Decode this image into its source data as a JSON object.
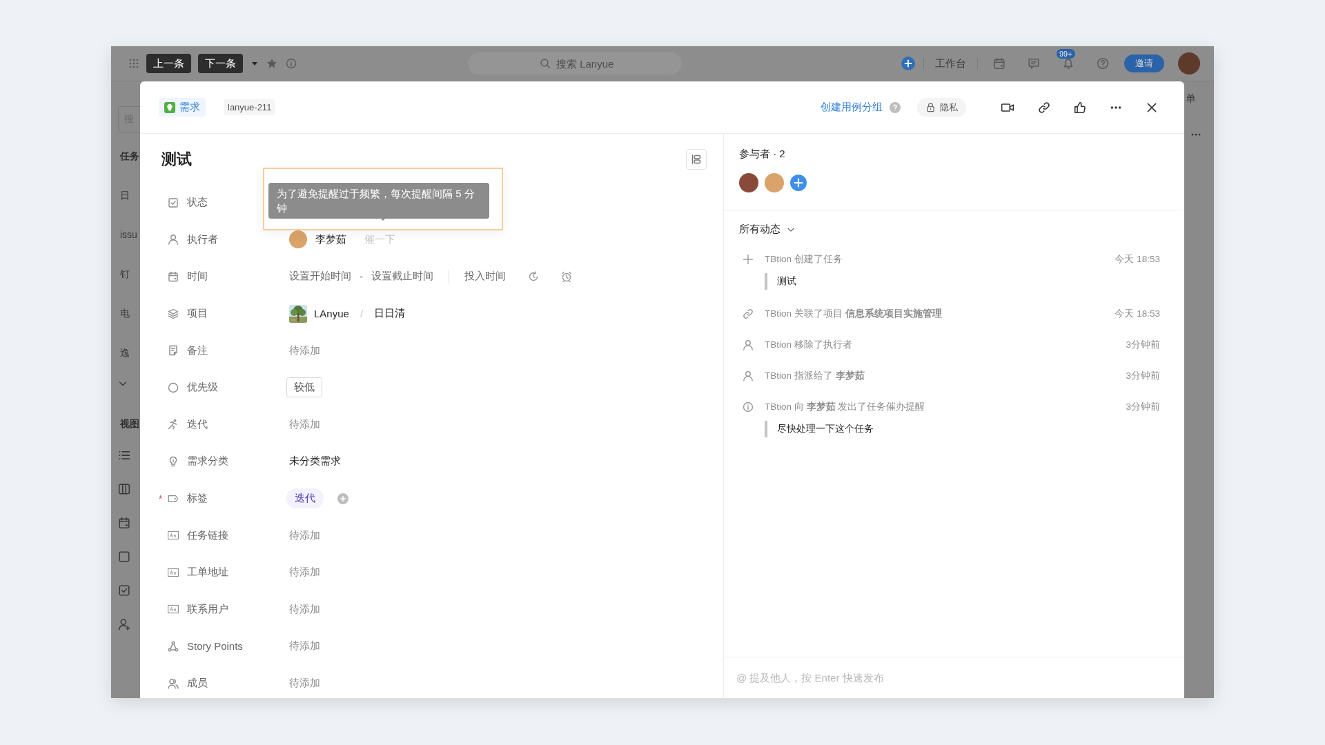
{
  "topbar": {
    "nav_buttons": [
      "上一条",
      "下一条"
    ],
    "search": {
      "placeholder": "搜索 Lanyue"
    },
    "workbench": "工作台",
    "notification_badge": "99+",
    "invite": "邀请"
  },
  "background": {
    "search_hint": "搜",
    "sidebar_items": [
      {
        "label": "任务",
        "kind": "heading"
      },
      {
        "label": "日",
        "kind": "item"
      },
      {
        "label": "issu",
        "kind": "item"
      },
      {
        "label": "钉",
        "kind": "item"
      },
      {
        "label": "电",
        "kind": "item"
      },
      {
        "label": "逸",
        "kind": "item"
      },
      {
        "label": "视图",
        "kind": "heading"
      }
    ],
    "right_tab": "单"
  },
  "modal": {
    "header": {
      "type_tag": "需求",
      "task_id": "lanyue-211",
      "create_group": "创建用例分组",
      "privacy": "隐私"
    },
    "task": {
      "title": "测试",
      "fields": [
        {
          "label": "状态",
          "kind": "status"
        },
        {
          "label": "执行者",
          "kind": "assignee",
          "name": "李梦茹",
          "nudge": "催一下"
        },
        {
          "label": "时间",
          "kind": "time",
          "start": "设置开始时间",
          "separator": "-",
          "end": "设置截止时间",
          "effort": "投入时间"
        },
        {
          "label": "项目",
          "kind": "project",
          "project": "LAnyue",
          "slash": "/",
          "group": "日日清"
        },
        {
          "label": "备注",
          "kind": "empty",
          "placeholder": "待添加"
        },
        {
          "label": "优先级",
          "kind": "chip",
          "value": "较低"
        },
        {
          "label": "迭代",
          "kind": "empty",
          "placeholder": "待添加"
        },
        {
          "label": "需求分类",
          "kind": "text",
          "value": "未分类需求"
        },
        {
          "label": "标签",
          "kind": "tag",
          "value": "迭代",
          "required_mark": "*"
        },
        {
          "label": "任务链接",
          "kind": "empty",
          "placeholder": "待添加"
        },
        {
          "label": "工单地址",
          "kind": "empty",
          "placeholder": "待添加"
        },
        {
          "label": "联系用户",
          "kind": "empty",
          "placeholder": "待添加"
        },
        {
          "label": "Story Points",
          "kind": "empty",
          "placeholder": "待添加"
        },
        {
          "label": "成员",
          "kind": "empty",
          "placeholder": "待添加"
        }
      ],
      "tooltip": "为了避免提醒过于频繁，每次提醒间隔 5 分钟"
    },
    "participants": {
      "label": "参与者 · 2",
      "avatars": [
        {
          "color": "#8a4a3a"
        },
        {
          "color": "#d9a36a"
        }
      ]
    },
    "activity_filter": "所有动态",
    "activities": [
      {
        "kind": "create",
        "text": "TBtion 创建了任务",
        "time": "今天 18:53",
        "quote": "测试"
      },
      {
        "kind": "link",
        "text": "TBtion 关联了项目 **信息系统项目实施管理**",
        "time": "今天 18:53"
      },
      {
        "kind": "user",
        "text": "TBtion 移除了执行者",
        "time": "3分钟前"
      },
      {
        "kind": "user",
        "text": "TBtion 指派给了 **李梦茹**",
        "time": "3分钟前"
      },
      {
        "kind": "info",
        "text": "TBtion 向 **李梦茹** 发出了任务催办提醒",
        "time": "3分钟前",
        "quote": "尽快处理一下这个任务"
      }
    ],
    "comment": {
      "placeholder": "@ 提及他人，按 Enter 快速发布"
    }
  }
}
